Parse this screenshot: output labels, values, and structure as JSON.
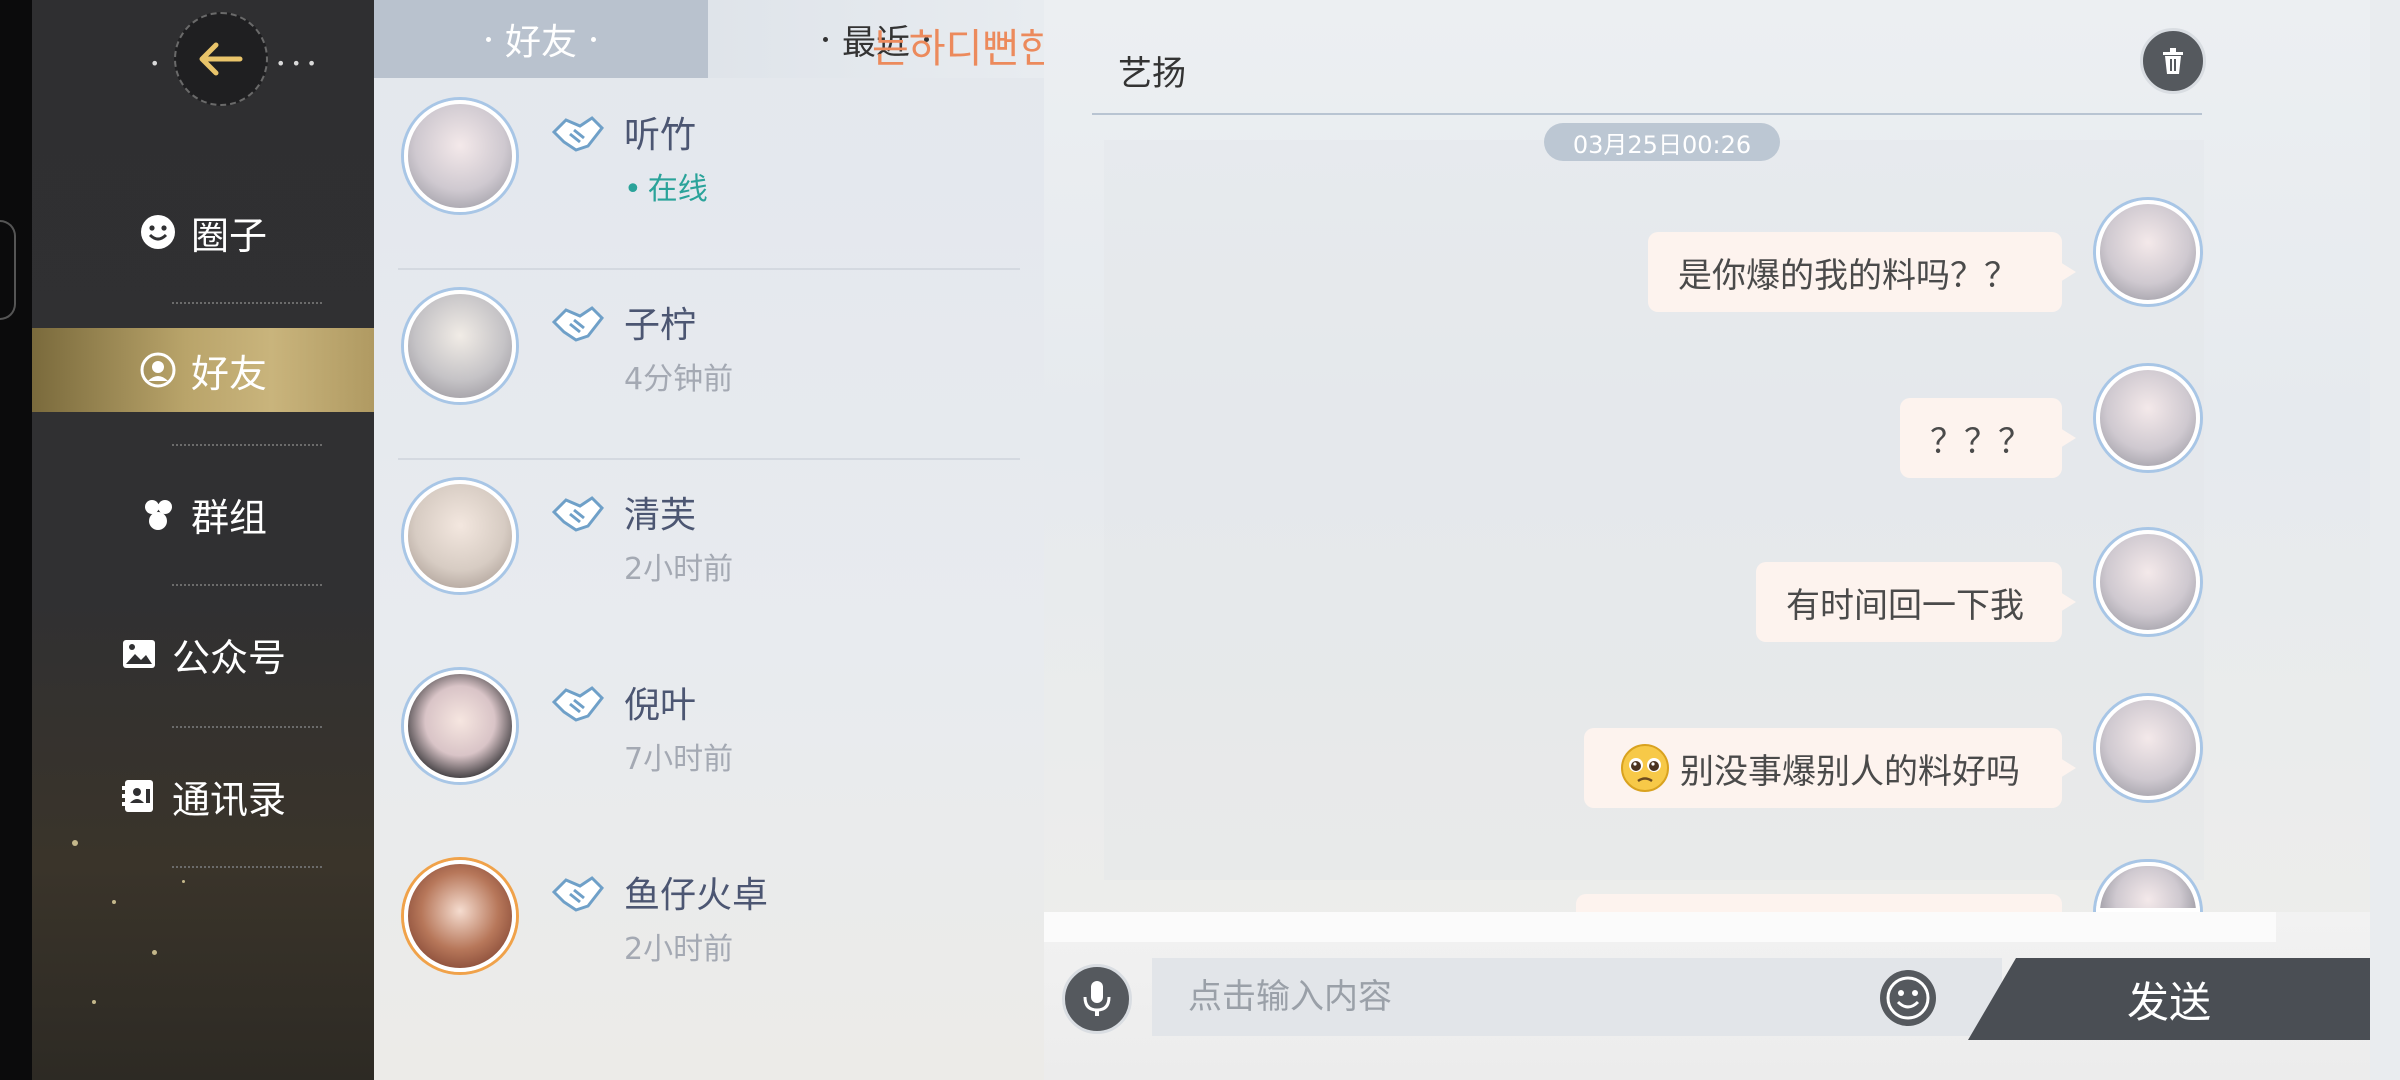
{
  "sidebar": {
    "items": [
      {
        "label": "圈子",
        "icon": "smiley-icon"
      },
      {
        "label": "好友",
        "icon": "friend-face-icon",
        "active": true
      },
      {
        "label": "群组",
        "icon": "group-icon"
      },
      {
        "label": "公众号",
        "icon": "image-icon"
      },
      {
        "label": "通讯录",
        "icon": "address-book-icon"
      }
    ]
  },
  "tabs": {
    "friends": "好友",
    "recent": "最近"
  },
  "overlay_text": "는하디뻔한 이「",
  "friends": [
    {
      "name": "听竹",
      "status": "在线"
    },
    {
      "name": "子柠",
      "status": "4分钟前"
    },
    {
      "name": "清芙",
      "status": "2小时前"
    },
    {
      "name": "倪叶",
      "status": "7小时前"
    },
    {
      "name": "鱼仔火卓",
      "status": "2小时前"
    }
  ],
  "chat": {
    "title": "艺扬",
    "timestamp": "03月25日00:26",
    "messages": [
      {
        "text": "是你爆的我的料吗？？"
      },
      {
        "text": "？？？"
      },
      {
        "text": "有时间回一下我"
      },
      {
        "text": "别没事爆别人的料好吗",
        "emoji": "pleading-face-icon"
      }
    ]
  },
  "input": {
    "placeholder": "点击输入内容",
    "send_label": "发送"
  },
  "colors": {
    "accent_gold": "#c9b47c",
    "online_green": "#2aa39a",
    "bubble": "#fdf3ee",
    "sidebar_bg": "#2f2f31"
  }
}
